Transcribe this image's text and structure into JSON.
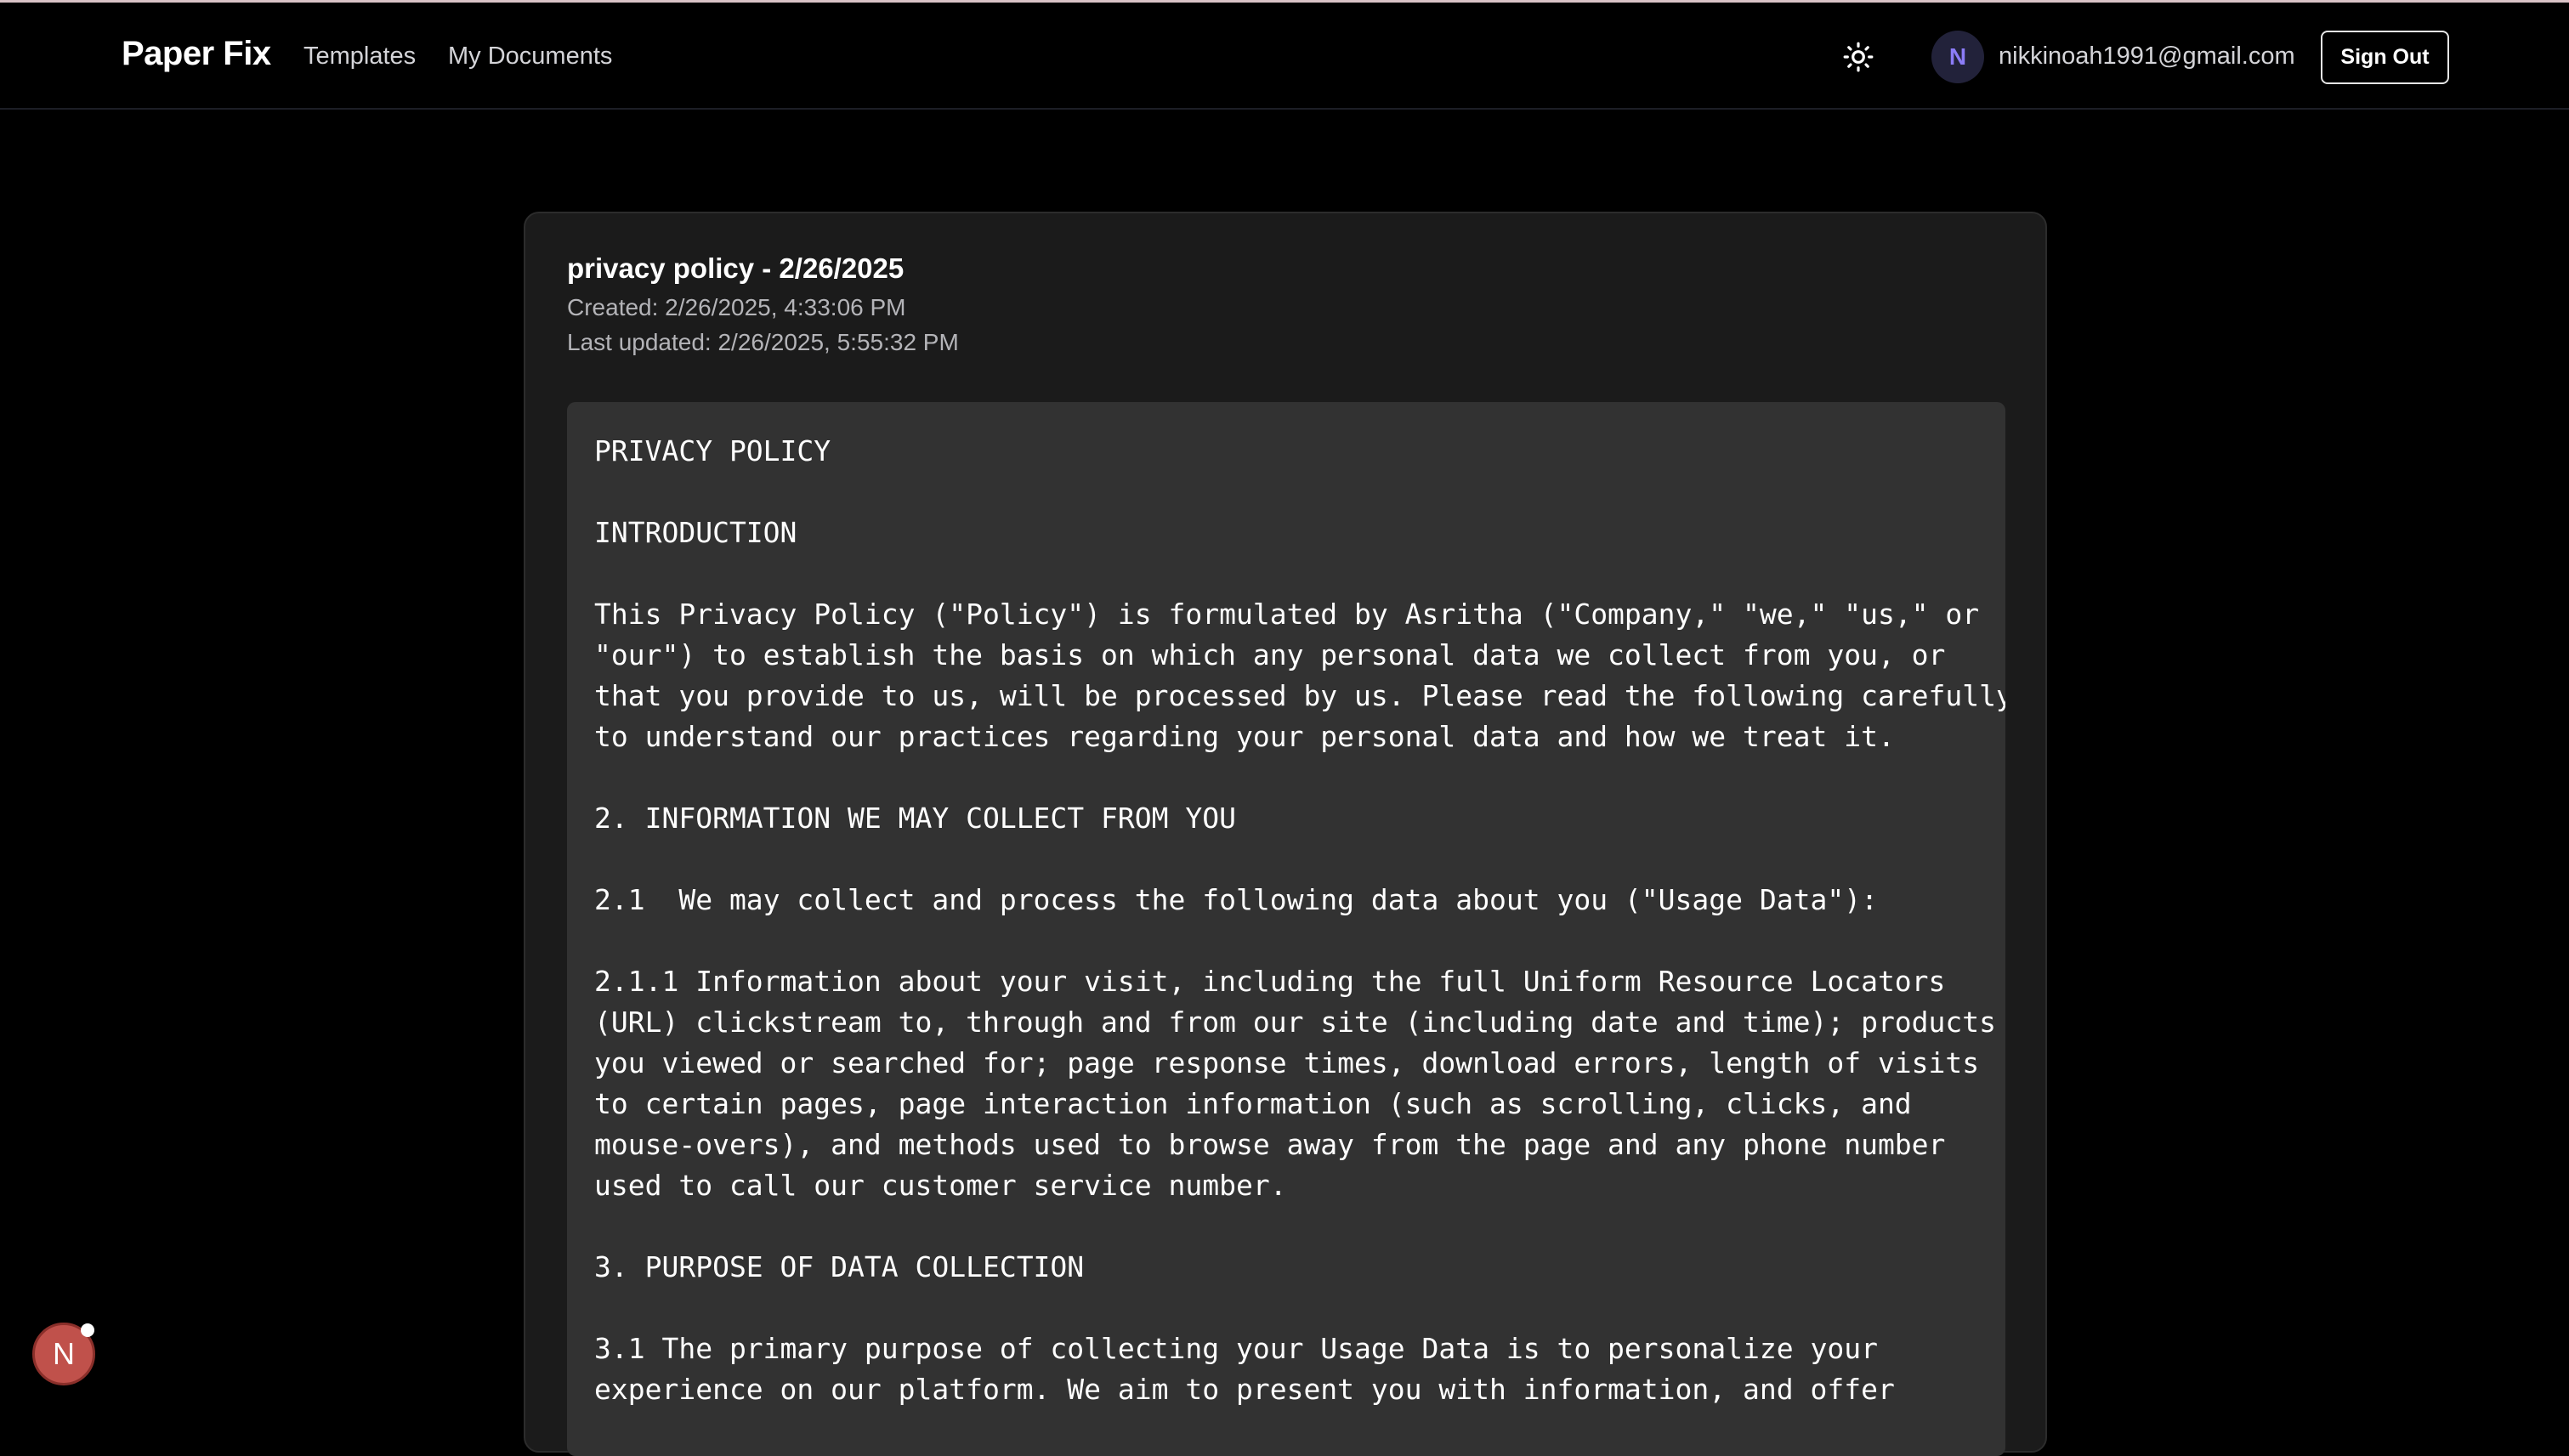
{
  "navbar": {
    "brand": "Paper Fix",
    "links": [
      "Templates",
      "My Documents"
    ],
    "theme_toggle_icon": "sun-icon",
    "user": {
      "avatar_initial": "N",
      "email": "nikkinoah1991@gmail.com"
    },
    "signout_label": "Sign Out"
  },
  "document": {
    "title": "privacy policy - 2/26/2025",
    "created": "Created: 2/26/2025, 4:33:06 PM",
    "updated": "Last updated: 2/26/2025, 5:55:32 PM",
    "content": "PRIVACY POLICY\n\nINTRODUCTION\n\nThis Privacy Policy (\"Policy\") is formulated by Asritha (\"Company,\" \"we,\" \"us,\" or\n\"our\") to establish the basis on which any personal data we collect from you, or\nthat you provide to us, will be processed by us. Please read the following carefully\nto understand our practices regarding your personal data and how we treat it.\n\n2. INFORMATION WE MAY COLLECT FROM YOU\n\n2.1  We may collect and process the following data about you (\"Usage Data\"):\n\n2.1.1 Information about your visit, including the full Uniform Resource Locators\n(URL) clickstream to, through and from our site (including date and time); products\nyou viewed or searched for; page response times, download errors, length of visits\nto certain pages, page interaction information (such as scrolling, clicks, and\nmouse-overs), and methods used to browse away from the page and any phone number\nused to call our customer service number.\n\n3. PURPOSE OF DATA COLLECTION\n\n3.1 The primary purpose of collecting your Usage Data is to personalize your\nexperience on our platform. We aim to present you with information, and offer"
  },
  "floating_badge": {
    "label": "N"
  },
  "colors": {
    "background": "#000000",
    "card": "#1b1b1b",
    "content_box": "#323232",
    "avatar_text": "#8b7cf6",
    "badge": "#c0514b"
  }
}
